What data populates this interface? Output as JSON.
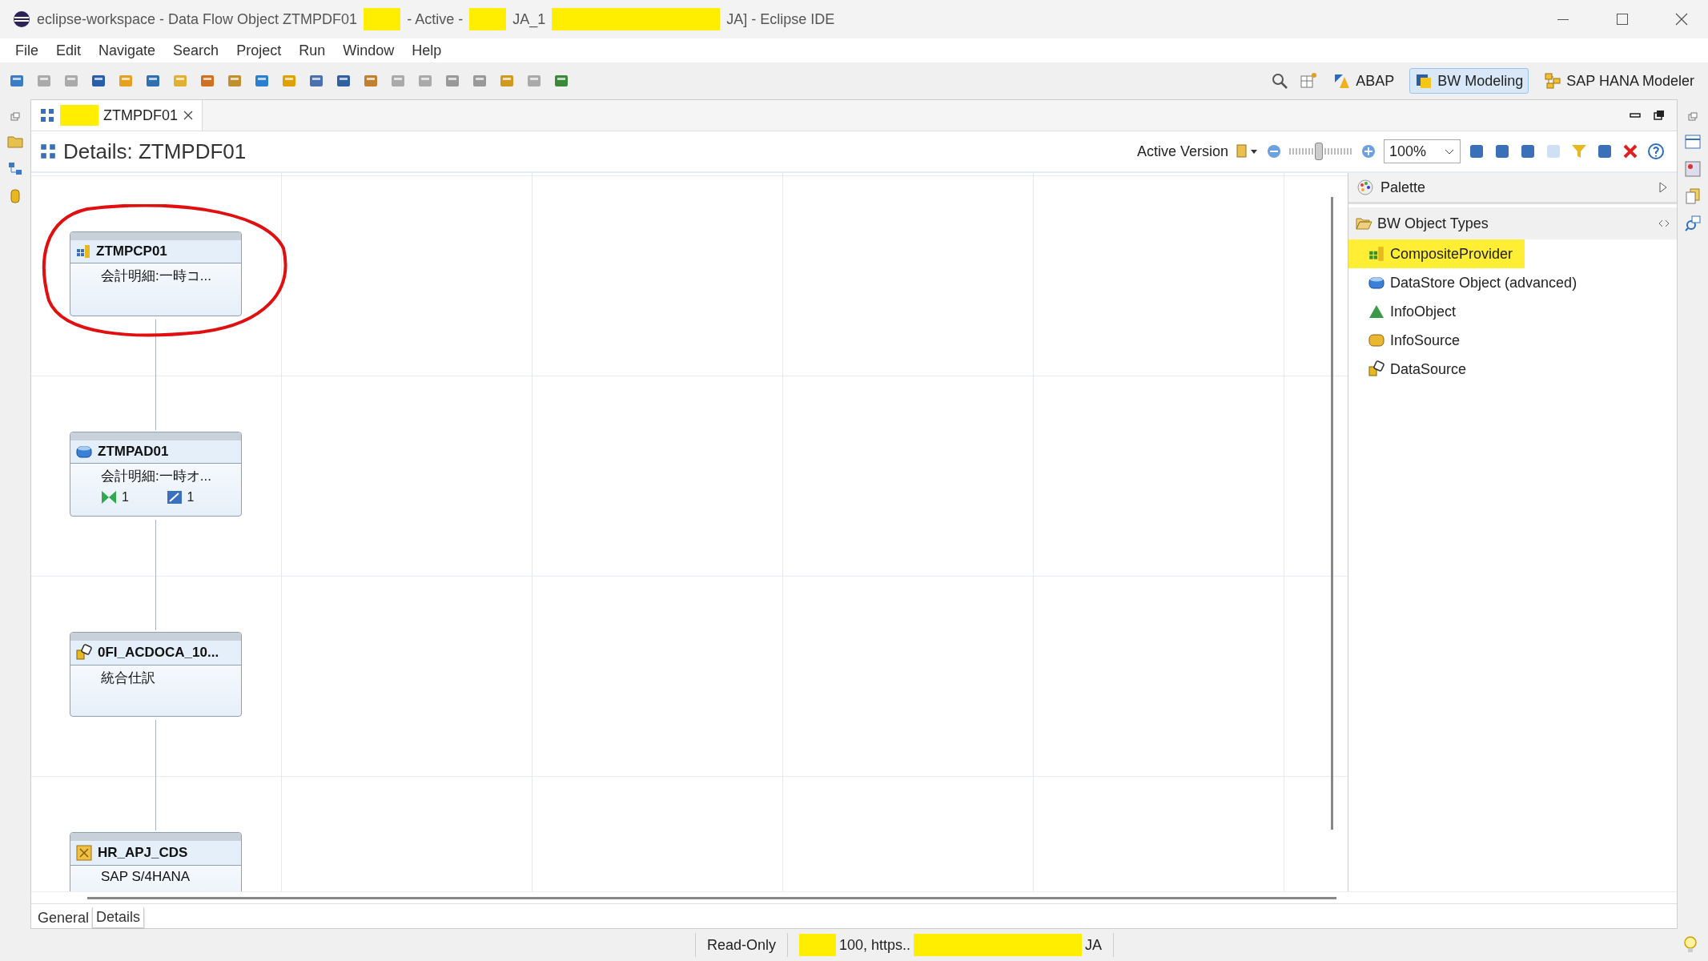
{
  "window": {
    "title_parts": [
      {
        "kind": "text",
        "text": "eclipse-workspace - Data Flow Object ZTMPDF01"
      },
      {
        "kind": "redacted"
      },
      {
        "kind": "text",
        "text": "- Active -"
      },
      {
        "kind": "redacted"
      },
      {
        "kind": "text",
        "text": "JA_1"
      },
      {
        "kind": "redacted",
        "wide": true
      },
      {
        "kind": "text",
        "text": "JA] - Eclipse IDE"
      }
    ]
  },
  "menu": [
    "File",
    "Edit",
    "Navigate",
    "Search",
    "Project",
    "Run",
    "Window",
    "Help"
  ],
  "perspectives": [
    {
      "label": "ABAP",
      "kind": "abap",
      "selected": false
    },
    {
      "label": "BW Modeling",
      "kind": "bw",
      "selected": true
    },
    {
      "label": "SAP HANA Modeler",
      "kind": "hana",
      "selected": false
    }
  ],
  "editor_tab": {
    "label": "ZTMPDF01",
    "redacted_prefix": true
  },
  "details": {
    "title": "Details: ZTMPDF01",
    "version": "Active Version",
    "zoom_slider": {
      "level": 0.45
    },
    "zoom": "100%"
  },
  "nodes": [
    {
      "kind": "composite",
      "name": "ZTMPCP01",
      "description": "会計明細:一時コ...",
      "annotated": true
    },
    {
      "kind": "datastore",
      "name": "ZTMPAD01",
      "description": "会計明細:一時オ...",
      "annotated": false,
      "counts": [
        {
          "kind": "transformation",
          "text": "1"
        },
        {
          "kind": "dtp",
          "text": "1"
        }
      ]
    },
    {
      "kind": "datasource",
      "name": "0FI_ACDOCA_10...",
      "description": "統合仕訳",
      "annotated": false
    },
    {
      "kind": "source_system",
      "name": "HR_APJ_CDS",
      "description": "SAP S/4HANA",
      "annotated": false
    }
  ],
  "palette": {
    "title": "Palette",
    "group": {
      "label": "BW Object Types",
      "expanded": true,
      "items": [
        {
          "kind": "composite",
          "label": "CompositeProvider",
          "highlighted": true
        },
        {
          "kind": "datastore",
          "label": "DataStore Object (advanced)",
          "highlighted": false
        },
        {
          "kind": "infoobject",
          "label": "InfoObject",
          "highlighted": false
        },
        {
          "kind": "infosource",
          "label": "InfoSource",
          "highlighted": false
        },
        {
          "kind": "datasource",
          "label": "DataSource",
          "highlighted": false
        }
      ]
    }
  },
  "bottom_tabs": [
    {
      "label": "General",
      "selected": false
    },
    {
      "label": "Details",
      "selected": true
    }
  ],
  "status_bar": {
    "mode": "Read-Only",
    "connection_parts": [
      {
        "kind": "redacted"
      },
      {
        "kind": "text",
        "text": "100, https.."
      },
      {
        "kind": "redacted",
        "wide": true
      },
      {
        "kind": "text",
        "text": "JA"
      }
    ]
  }
}
